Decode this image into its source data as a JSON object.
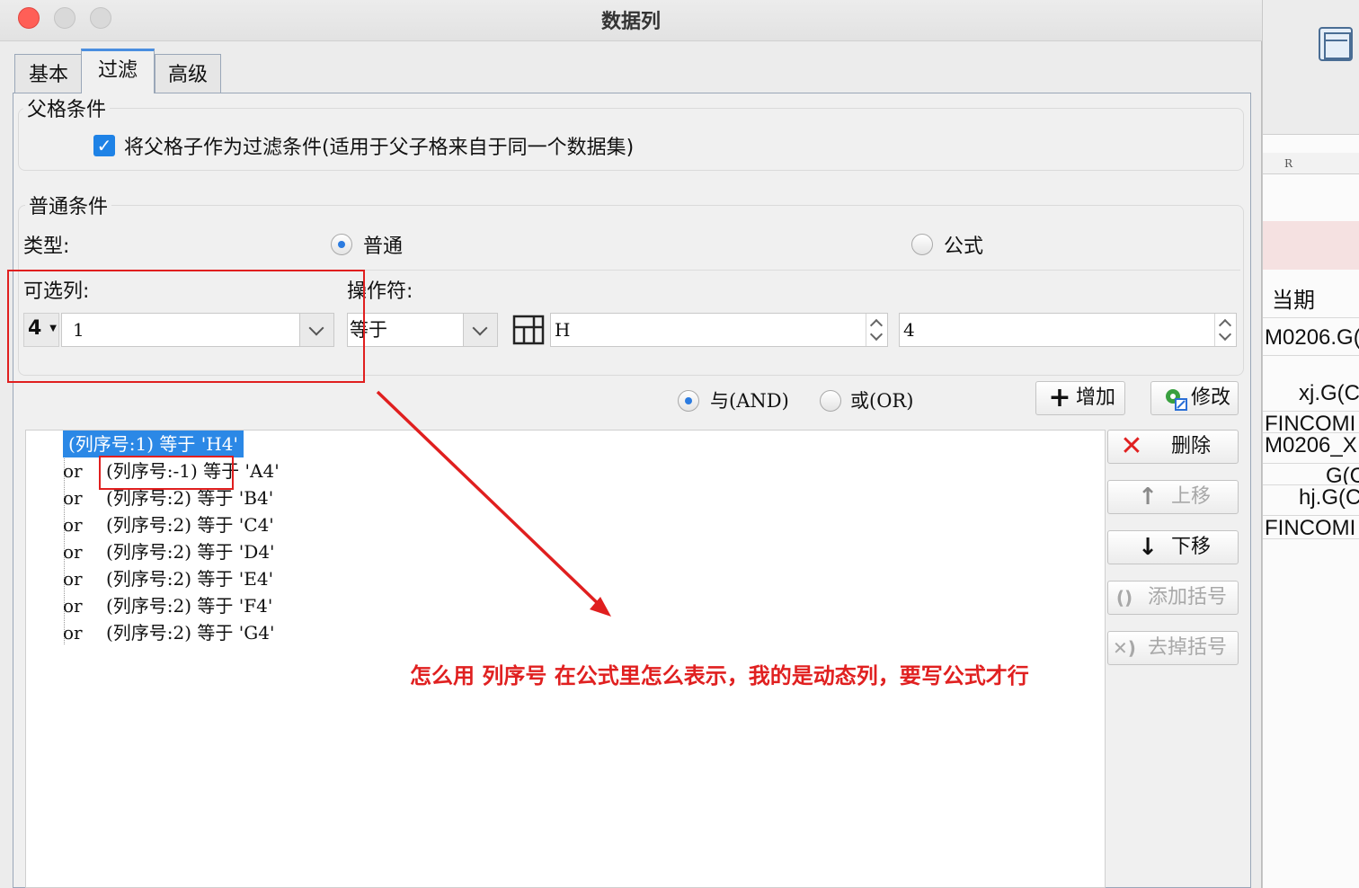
{
  "dialog": {
    "title": "数据列",
    "tabs": [
      {
        "label": "基本"
      },
      {
        "label": "过滤"
      },
      {
        "label": "高级"
      }
    ]
  },
  "parent_condition": {
    "title": "父格条件",
    "checkbox_label": "将父格子作为过滤条件(适用于父子格来自于同一个数据集)",
    "checked": true
  },
  "normal_condition": {
    "title": "普通条件",
    "type_label": "类型:",
    "type_options": [
      {
        "label": "普通",
        "selected": true
      },
      {
        "label": "公式",
        "selected": false
      }
    ],
    "column_label": "可选列:",
    "operator_label": "操作符:",
    "column_indicator": "4",
    "column_value": "1",
    "operator_value": "等于",
    "value_field": "H",
    "value_field2": "4"
  },
  "logic": {
    "and_label": "与(AND)",
    "or_label": "或(OR)",
    "selected": "and"
  },
  "buttons": {
    "add": "增加",
    "modify": "修改",
    "delete": "删除",
    "move_up": "上移",
    "move_down": "下移",
    "add_bracket": "添加括号",
    "remove_bracket": "去掉括号"
  },
  "conditions": [
    {
      "op": "",
      "text": "(列序号:1) 等于 'H4'"
    },
    {
      "op": "or",
      "text": "(列序号:-1) 等于 'A4'"
    },
    {
      "op": "or",
      "text": "(列序号:2) 等于 'B4'"
    },
    {
      "op": "or",
      "text": "(列序号:2) 等于 'C4'"
    },
    {
      "op": "or",
      "text": "(列序号:2) 等于 'D4'"
    },
    {
      "op": "or",
      "text": "(列序号:2) 等于 'E4'"
    },
    {
      "op": "or",
      "text": "(列序号:2) 等于 'F4'"
    },
    {
      "op": "or",
      "text": "(列序号:2) 等于 'G4'"
    }
  ],
  "annotation": "怎么用 列序号 在公式里怎么表示，我的是动态列，要写公式才行",
  "sheet": {
    "column_header": "R",
    "cells": [
      "当期",
      "M0206.G(",
      "xj.G(C",
      "FINCOMI",
      "M0206_X",
      "G(C",
      "hj.G(C",
      "FINCOMI"
    ]
  },
  "colors": {
    "accent": "#2b88e6",
    "annotation": "#e02020"
  }
}
